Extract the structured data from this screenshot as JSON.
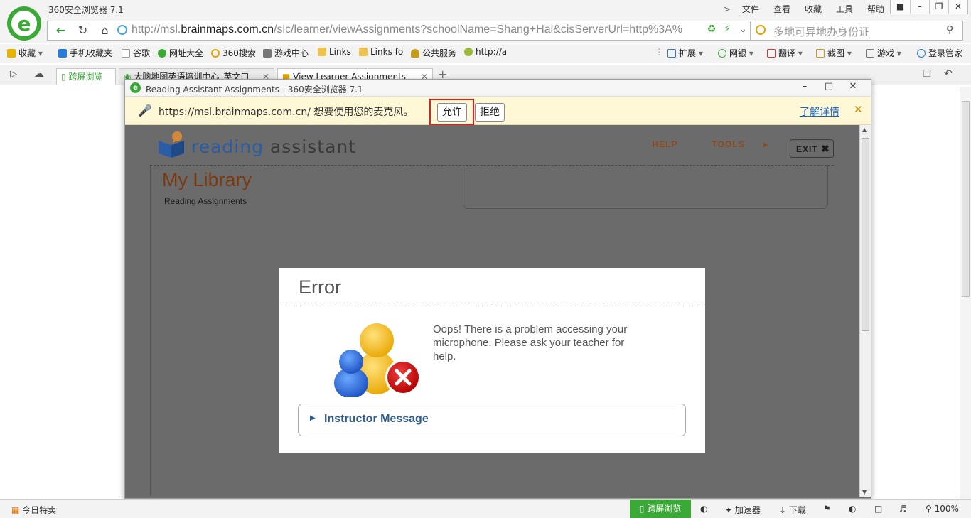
{
  "app": {
    "title": "360安全浏览器 7.1"
  },
  "top_menu": [
    "文件",
    "查看",
    "收藏",
    "工具",
    "帮助"
  ],
  "window_controls": [
    "shirt-icon",
    "minimize-icon",
    "restore-icon",
    "close-icon"
  ],
  "address": {
    "url_prefix": "http://msl.",
    "url_domain": "brainmaps.com.cn",
    "url_rest": "/slc/learner/viewAssignments?schoolName=Shang+Hai&cisServerUrl=http%3A%",
    "search_placeholder": "多地可异地办身份证"
  },
  "bookmarks": {
    "left": [
      "收藏",
      "手机收藏夹",
      "谷歌",
      "网址大全",
      "360搜索",
      "游戏中心",
      "Links",
      "Links fo",
      "公共服务",
      "http://a"
    ],
    "right": [
      "扩展",
      "网银",
      "翻译",
      "截图",
      "游戏",
      "登录管家"
    ]
  },
  "tabs": [
    {
      "label": "跨屏浏览"
    },
    {
      "label": "大脑地图英语培训中心_英文口"
    },
    {
      "label": "View Learner Assignments"
    }
  ],
  "status_bar": {
    "left": "今日特卖",
    "kuaping": "跨屏浏览",
    "accelerator": "加速器",
    "download": "下载",
    "zoom": "100%"
  },
  "popup": {
    "title": "Reading Assistant Assignments - 360安全浏览器 7.1",
    "infobar": {
      "text": "https://msl.brainmaps.com.cn/ 想要使用您的麦克风。",
      "allow": "允许",
      "deny": "拒绝",
      "learn_more": "了解详情",
      "close": "✕"
    }
  },
  "page": {
    "logo_reading": "reading",
    "logo_assistant": "assistant",
    "nav_help": "HELP",
    "nav_tools": "TOOLS",
    "nav_exit": "EXIT",
    "heading": "My Library",
    "subheading": "Reading Assignments"
  },
  "error_dialog": {
    "title": "Error",
    "message": "Oops! There is a problem accessing your microphone. Please ask your teacher for help.",
    "instructor_label": "Instructor Message"
  },
  "colors": {
    "brand_green": "#3aa935",
    "highlight_red": "#e02020",
    "link_blue": "#1a64c8"
  }
}
